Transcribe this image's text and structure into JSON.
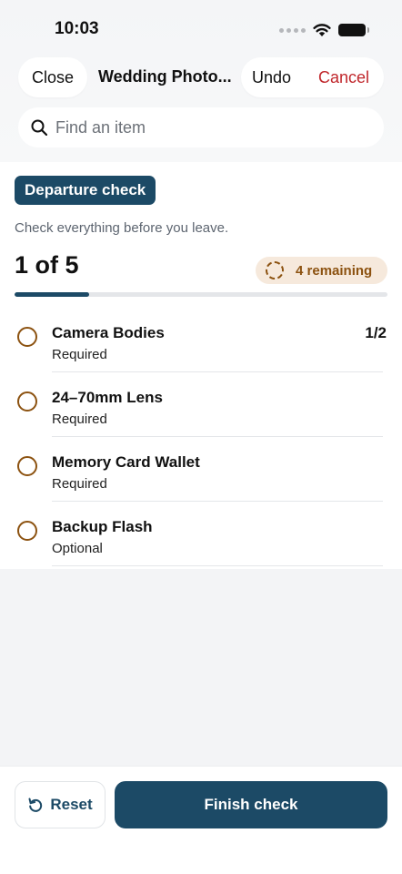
{
  "status_bar": {
    "time": "10:03"
  },
  "header": {
    "close_label": "Close",
    "title": "Wedding Photo...",
    "undo_label": "Undo",
    "cancel_label": "Cancel"
  },
  "search": {
    "placeholder": "Find an item",
    "value": ""
  },
  "check": {
    "badge": "Departure check",
    "subtitle": "Check everything before you leave.",
    "count": "1 of 5",
    "remaining": "4 remaining",
    "progress_fraction": 0.2
  },
  "items": [
    {
      "name": "Camera Bodies",
      "tag": "Required",
      "qty": "1/2"
    },
    {
      "name": "24–70mm Lens",
      "tag": "Required",
      "qty": ""
    },
    {
      "name": "Memory Card Wallet",
      "tag": "Required",
      "qty": ""
    },
    {
      "name": "Backup Flash",
      "tag": "Optional",
      "qty": ""
    }
  ],
  "footer": {
    "reset_label": "Reset",
    "finish_label": "Finish check"
  },
  "colors": {
    "accent": "#1c4a66",
    "warning": "#8c5210",
    "danger": "#c0262b"
  }
}
